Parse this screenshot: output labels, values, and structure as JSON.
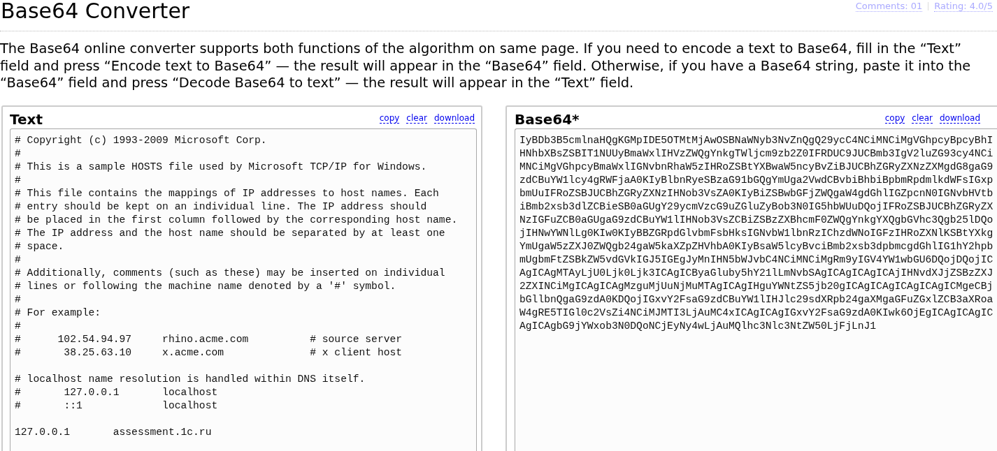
{
  "header": {
    "title": "Base64 Converter",
    "links": [
      {
        "label": "Comments: 01"
      },
      {
        "label": "Rating: 4.0/5"
      }
    ]
  },
  "intro": "The Base64 online converter supports both functions of the algorithm on same page. If you need to encode a text to Base64, fill in the “Text” field and press “Encode text to Base64” — the result will appear in the “Base64” field. Otherwise, if you have a Base64 string, paste it into the “Base64” field and press “Decode Base64 to text” — the result will appear in the “Text” field.",
  "panels": [
    {
      "title": "Text",
      "kind": "text",
      "actions": [
        "copy",
        "clear",
        "download"
      ],
      "value": "# Copyright (c) 1993-2009 Microsoft Corp.\n#\n# This is a sample HOSTS file used by Microsoft TCP/IP for Windows.\n#\n# This file contains the mappings of IP addresses to host names. Each\n# entry should be kept on an individual line. The IP address should\n# be placed in the first column followed by the corresponding host name.\n# The IP address and the host name should be separated by at least one\n# space.\n#\n# Additionally, comments (such as these) may be inserted on individual\n# lines or following the machine name denoted by a '#' symbol.\n#\n# For example:\n#\n#      102.54.94.97     rhino.acme.com          # source server\n#       38.25.63.10     x.acme.com              # x client host\n\n# localhost name resolution is handled within DNS itself.\n#\t127.0.0.1       localhost\n#\t::1             localhost\n\n127.0.0.1\tassessment.1c.ru"
    },
    {
      "title": "Base64*",
      "kind": "base64",
      "actions": [
        "copy",
        "clear",
        "download"
      ],
      "value": "IyBDb3B5cmlnaHQgKGMpIDE5OTMtMjAwOSBNaWNyb3NvZnQgQ29ycC4NCiMNCiMgVGhpcyBpcyBhIHNhbXBsZSBIT1NUUyBmaWxlIHVzZWQgYnkgTWljcm9zb2Z0IFRDUC9JUCBmb3IgV2luZG93cy4NCiMNCiMgVGhpcyBmaWxlIGNvbnRhaW5zIHRoZSBtYXBwaW5ncyBvZiBJUCBhZGRyZXNzZXMgdG8gaG9zdCBuYW1lcy4gRWFjaA0KIyBlbnRyeSBzaG91bGQgYmUga2VwdCBvbiBhbiBpbmRpdmlkdWFsIGxpbmUuIFRoZSBJUCBhZGRyZXNzIHNob3VsZA0KIyBiZSBwbGFjZWQgaW4gdGhlIGZpcnN0IGNvbHVtbiBmb2xsb3dlZCBieSB0aGUgY29ycmVzcG9uZGluZyBob3N0IG5hbWUuDQojIFRoZSBJUCBhZGRyZXNzIGFuZCB0aGUgaG9zdCBuYW1lIHNob3VsZCBiZSBzZXBhcmF0ZWQgYnkgYXQgbGVhc3Qgb25lDQojIHNwYWNlLg0KIw0KIyBBZGRpdGlvbmFsbHksIGNvbW1lbnRzIChzdWNoIGFzIHRoZXNlKSBtYXkgYmUgaW5zZXJ0ZWQgb24gaW5kaXZpZHVhbA0KIyBsaW5lcyBvciBmb2xsb3dpbmcgdGhlIG1hY2hpbmUgbmFtZSBkZW5vdGVkIGJ5IGEgJyMnIHN5bWJvbC4NCiMNCiMgRm9yIGV4YW1wbGU6DQojDQojICAgICAgMTAyLjU0Ljk0Ljk3ICAgICByaGluby5hY21lLmNvbSAgICAgICAgICAjIHNvdXJjZSBzZXJ2ZXINCiMgICAgICAgMzguMjUuNjMuMTAgICAgIHguYWNtZS5jb20gICAgICAgICAgICAgICMgeCBjbGllbnQgaG9zdA0KDQojIGxvY2FsaG9zdCBuYW1lIHJlc29sdXRpb24gaXMgaGFuZGxlZCB3aXRoaW4gRE5TIGl0c2VsZi4NCiMJMTI3LjAuMC4xICAgICAgIGxvY2FsaG9zdA0KIwk6OjEgICAgICAgICAgICAgbG9jYWxob3N0DQoNCjEyNy4wLjAuMQlhc3Nlc3NtZW50LjFjLnJ1"
    }
  ]
}
